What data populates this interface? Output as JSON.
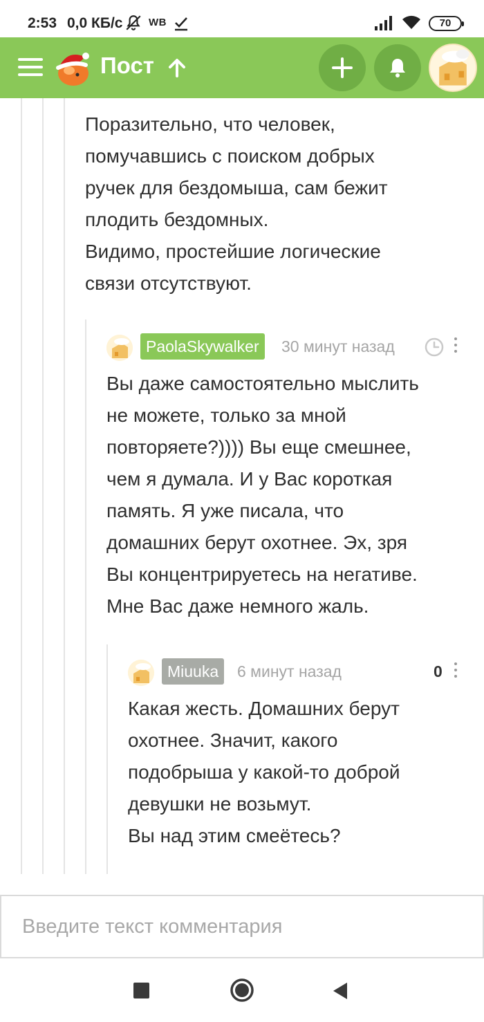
{
  "status_bar": {
    "time": "2:53",
    "net_speed": "0,0 КБ/с",
    "wb": "WB",
    "battery": "70"
  },
  "header": {
    "title": "Пост"
  },
  "comments": [
    {
      "text": "Поразительно, что человек,\nпомучавшись с поиском добрых\nручек для бездомыша, сам бежит\nплодить бездомных.\nВидимо, простейшие логические\nсвязи отсутствуют."
    },
    {
      "author": "PaolaSkywalker",
      "time": "30 минут назад",
      "text": "Вы даже самостоятельно мыслить\nне можете, только за мной\nповторяете?)))) Вы еще смешнее,\nчем я думала. И у Вас короткая\nпамять. Я уже писала, что\nдомашних берут охотнее. Эх, зря\nВы концентрируетесь на негативе.\nМне Вас даже немного жаль."
    },
    {
      "author": "Miuuka",
      "time": "6 минут назад",
      "rating": "0",
      "text": "Какая жесть. Домашних берут\nохотнее. Значит, какого\nподобрыша у какой-то доброй\nдевушки не возьмут.\nВы над этим смеётесь?"
    }
  ],
  "input": {
    "placeholder": "Введите текст комментария"
  },
  "colors": {
    "header_bg": "#8ac858",
    "header_button_bg": "#70ae45",
    "nick_green": "#8ac858",
    "nick_gray": "#a8aba6"
  }
}
